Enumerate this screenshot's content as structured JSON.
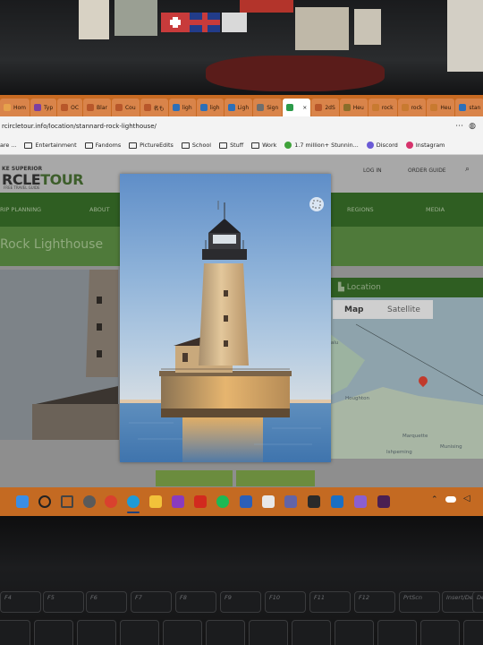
{
  "browser": {
    "tabs": [
      {
        "label": "Hom",
        "color": "#e6a14c"
      },
      {
        "label": "Typ",
        "color": "#7b3fa0"
      },
      {
        "label": "OC",
        "color": "#b8572a"
      },
      {
        "label": "Blar",
        "color": "#b8572a"
      },
      {
        "label": "Cou",
        "color": "#b8572a"
      },
      {
        "label": "名も",
        "color": "#b8572a"
      },
      {
        "label": "ligh",
        "color": "#2d6fb8"
      },
      {
        "label": "ligh",
        "color": "#2d6fb8"
      },
      {
        "label": "Ligh",
        "color": "#2d6fb8"
      },
      {
        "label": "Sign",
        "color": "#6e6e6e"
      },
      {
        "label": "",
        "color": "#2c9b4a",
        "active": true,
        "close": "×"
      },
      {
        "label": "2dS",
        "color": "#b8572a"
      },
      {
        "label": "Heu",
        "color": "#8a6d2a"
      },
      {
        "label": "rock",
        "color": "#c87a30"
      },
      {
        "label": "rock",
        "color": "#c87a30"
      },
      {
        "label": "Heu",
        "color": "#c87a30"
      },
      {
        "label": "stan",
        "color": "#2d6fb8"
      }
    ],
    "url": "rcircletour.info/location/stannard-rock-lighthouse/",
    "bookmarks": [
      {
        "label": "are ...",
        "type": "text"
      },
      {
        "label": "Entertainment",
        "type": "folder"
      },
      {
        "label": "Fandoms",
        "type": "folder"
      },
      {
        "label": "PictureEdits",
        "type": "folder"
      },
      {
        "label": "School",
        "type": "folder"
      },
      {
        "label": "Stuff",
        "type": "folder"
      },
      {
        "label": "Work",
        "type": "folder"
      },
      {
        "label": "1.7 million+ Stunnin...",
        "type": "site",
        "color": "#3fa23a"
      },
      {
        "label": "Discord",
        "type": "site",
        "color": "#6b5bd6"
      },
      {
        "label": "Instagram",
        "type": "site",
        "color": "#d6336c"
      }
    ]
  },
  "site": {
    "logo_top": "KE SUPERIOR",
    "logo_main_a": "RCLE",
    "logo_main_b": "TOUR",
    "logo_sub": "FREE TRAVEL GUIDE",
    "login": "LOG IN",
    "order_guide": "ORDER GUIDE",
    "nav": [
      "RIP PLANNING",
      "ABOUT",
      "REGIONS",
      "MEDIA"
    ],
    "page_title": "Rock Lighthouse",
    "location_label": "Location",
    "map": {
      "map_button": "Map",
      "satellite_button": "Satellite",
      "labels": [
        "Houghton",
        "Marquette",
        "Munising",
        "Ishpeming"
      ],
      "pin_color": "#d83a2b"
    }
  },
  "lightbox": {
    "expand_icon": "expand-icon",
    "subject": "lighthouse"
  },
  "taskbar": {
    "icons": [
      {
        "name": "windows-start-icon",
        "color": "#3a8ee6"
      },
      {
        "name": "search-icon",
        "color": "#222222"
      },
      {
        "name": "task-view-icon",
        "color": "#444444"
      },
      {
        "name": "settings-icon",
        "color": "#5a5a5a"
      },
      {
        "name": "chrome-icon",
        "color": "#d9412e"
      },
      {
        "name": "edge-icon",
        "color": "#1f9ad6"
      },
      {
        "name": "file-explorer-icon",
        "color": "#f2c23a"
      },
      {
        "name": "onenote-icon",
        "color": "#8a3bbf"
      },
      {
        "name": "acrobat-icon",
        "color": "#d22a1e"
      },
      {
        "name": "spotify-icon",
        "color": "#1db954"
      },
      {
        "name": "word-icon",
        "color": "#2b5fb8"
      },
      {
        "name": "cat-app-icon",
        "color": "#e8e8e8"
      },
      {
        "name": "teams-icon",
        "color": "#6264a7"
      },
      {
        "name": "fi-app-icon",
        "color": "#2a2a2a"
      },
      {
        "name": "outlook-icon",
        "color": "#1a6fc4"
      },
      {
        "name": "discord-app-icon",
        "color": "#8a5fd0"
      },
      {
        "name": "h-app-icon",
        "color": "#4a1f52"
      }
    ]
  },
  "keyboard": {
    "keys": [
      "F4",
      "F5",
      "F6",
      "F7",
      "F8",
      "F9",
      "F10",
      "F11",
      "F12",
      "PrtScn",
      "Insert/DelL",
      "Del"
    ]
  }
}
